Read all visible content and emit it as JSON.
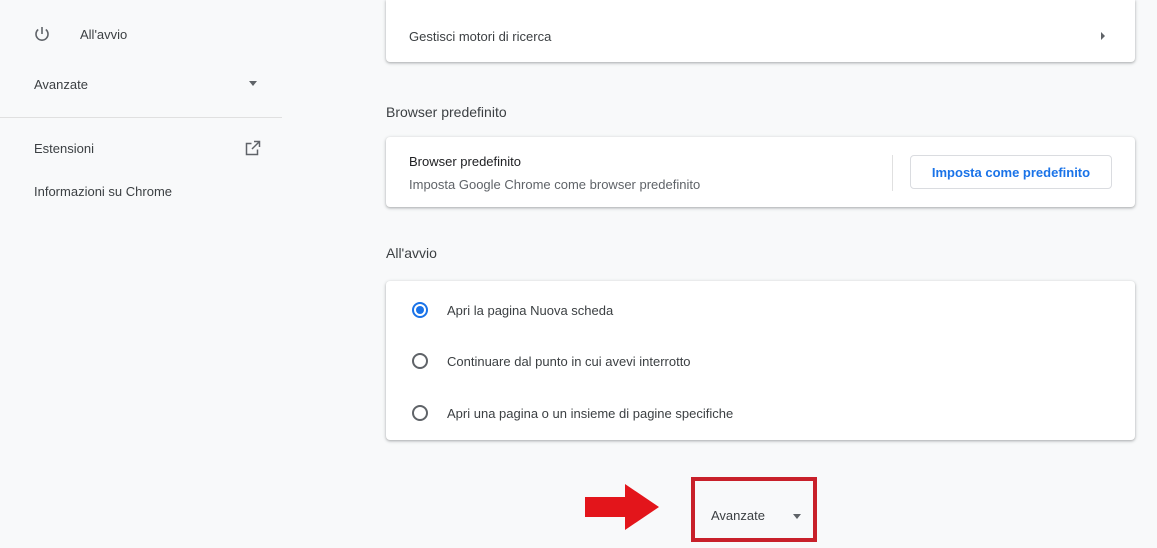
{
  "sidebar": {
    "startup_label": "All'avvio",
    "advanced_label": "Avanzate",
    "extensions_label": "Estensioni",
    "about_label": "Informazioni su Chrome"
  },
  "search_engines": {
    "manage_label": "Gestisci motori di ricerca"
  },
  "default_browser": {
    "section_title": "Browser predefinito",
    "primary": "Browser predefinito",
    "secondary": "Imposta Google Chrome come browser predefinito",
    "button_label": "Imposta come predefinito"
  },
  "startup": {
    "section_title": "All'avvio",
    "options": [
      {
        "label": "Apri la pagina Nuova scheda",
        "checked": true
      },
      {
        "label": "Continuare dal punto in cui avevi interrotto",
        "checked": false
      },
      {
        "label": "Apri una pagina o un insieme di pagine specifiche",
        "checked": false
      }
    ]
  },
  "advanced_toggle": {
    "label": "Avanzate"
  },
  "colors": {
    "accent": "#1a73e8",
    "highlight": "#c8202a",
    "arrow": "#e3151b"
  }
}
